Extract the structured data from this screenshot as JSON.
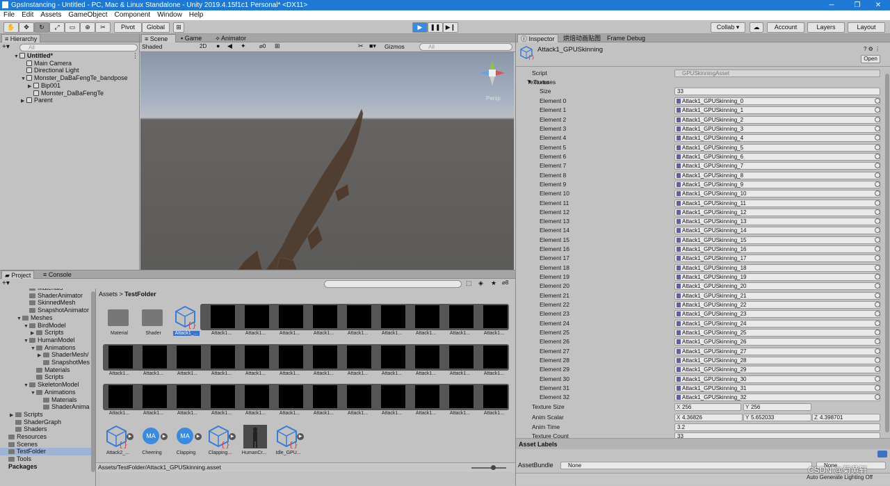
{
  "window": {
    "title": "GpsInstancing - Untitled - PC, Mac & Linux Standalone - Unity 2019.4.15f1c1 Personal* <DX11>",
    "minimize": "─",
    "maximize": "❐",
    "close": "✕"
  },
  "menu": [
    "File",
    "Edit",
    "Assets",
    "GameObject",
    "Component",
    "Window",
    "Help"
  ],
  "toolbar": {
    "pivot": "Pivot",
    "global": "Global",
    "collab": "Collab ▾",
    "account": "Account",
    "layers": "Layers",
    "layout": "Layout"
  },
  "hierarchy": {
    "tab": "Hierarchy",
    "search_placeholder": "All",
    "items": [
      {
        "label": "Untitled*",
        "level": 0,
        "icon": "unity-scene-icon",
        "expanded": true
      },
      {
        "label": "Main Camera",
        "level": 1,
        "icon": "cube-icon"
      },
      {
        "label": "Directional Light",
        "level": 1,
        "icon": "cube-icon"
      },
      {
        "label": "Monster_DaBaFengTe_bandpose",
        "level": 1,
        "icon": "cube-icon",
        "expanded": true
      },
      {
        "label": "Bip001",
        "level": 2,
        "icon": "cube-icon",
        "collapsed": true
      },
      {
        "label": "Monster_DaBaFengTe",
        "level": 2,
        "icon": "cube-icon"
      },
      {
        "label": "Parent",
        "level": 1,
        "icon": "cube-icon",
        "collapsed": true
      }
    ]
  },
  "scene": {
    "tabs": [
      "Scene",
      "Game",
      "Animator"
    ],
    "shading": "Shaded",
    "mode_2d": "2D",
    "hidden_count": "0",
    "gizmos": "Gizmos",
    "search_placeholder": "All",
    "persp": "Persp"
  },
  "project": {
    "tabs": [
      "Project",
      "Console"
    ],
    "zoom_count": "8",
    "tree": [
      {
        "label": "Materials",
        "level": 3
      },
      {
        "label": "ShaderAnimator",
        "level": 3
      },
      {
        "label": "SkinnedMesh",
        "level": 3
      },
      {
        "label": "SnapshotAnimator",
        "level": 3
      },
      {
        "label": "Meshes",
        "level": 2,
        "expanded": true
      },
      {
        "label": "BirdModel",
        "level": 3,
        "expanded": true
      },
      {
        "label": "Scripts",
        "level": 4,
        "collapsed": true
      },
      {
        "label": "HumanModel",
        "level": 3,
        "expanded": true
      },
      {
        "label": "Animations",
        "level": 4,
        "expanded": true
      },
      {
        "label": "ShaderMesh/",
        "level": 5,
        "collapsed": true
      },
      {
        "label": "SnapshotMes",
        "level": 5
      },
      {
        "label": "Materials",
        "level": 4
      },
      {
        "label": "Scripts",
        "level": 4
      },
      {
        "label": "SkeletonModel",
        "level": 3,
        "expanded": true
      },
      {
        "label": "Animations",
        "level": 4,
        "expanded": true
      },
      {
        "label": "Materials",
        "level": 5
      },
      {
        "label": "ShaderAnima",
        "level": 5
      },
      {
        "label": "Scripts",
        "level": 1,
        "collapsed": true
      },
      {
        "label": "ShaderGraph",
        "level": 1
      },
      {
        "label": "Shaders",
        "level": 1
      },
      {
        "label": "Resources",
        "level": 0
      },
      {
        "label": "Scenes",
        "level": 0
      },
      {
        "label": "TestFolder",
        "level": 0,
        "selected": true
      },
      {
        "label": "Tools",
        "level": 0
      },
      {
        "label": "Packages",
        "level": -1,
        "bold": true
      }
    ],
    "breadcrumb": [
      "Assets",
      "TestFolder"
    ],
    "row1_items": [
      "Material",
      "Shader",
      "Attack1_...",
      "Attack1...",
      "Attack1...",
      "Attack1...",
      "Attack1...",
      "Attack1...",
      "Attack1...",
      "Attack1...",
      "Attack1...",
      "Attack1..."
    ],
    "row2_items": [
      "Attack1...",
      "Attack1...",
      "Attack1...",
      "Attack1...",
      "Attack1...",
      "Attack1...",
      "Attack1...",
      "Attack1...",
      "Attack1...",
      "Attack1...",
      "Attack1...",
      "Attack1..."
    ],
    "row3_items": [
      "Attack1...",
      "Attack1...",
      "Attack1...",
      "Attack1...",
      "Attack1...",
      "Attack1...",
      "Attack1...",
      "Attack1...",
      "Attack1...",
      "Attack1...",
      "Attack1...",
      "Attack1..."
    ],
    "row4_items": [
      "Attack2_...",
      "Cheering",
      "Clapping",
      "Clapping...",
      "HumanCr...",
      "Idle_GPU..."
    ],
    "footer_path": "Assets/TestFolder/Attack1_GPUSkinning.asset"
  },
  "inspector": {
    "tabs": [
      "Inspector",
      "烘焙动画贴图",
      "Frame Debug"
    ],
    "asset_name": "Attack1_GPUSkinning",
    "open_button": "Open",
    "script_label": "Script",
    "script_value": "GPUSkinningAsset",
    "textures_label": "Textures",
    "size_label": "Size",
    "size_value": "33",
    "elements": [
      "Attack1_GPUSkinning_0",
      "Attack1_GPUSkinning_1",
      "Attack1_GPUSkinning_2",
      "Attack1_GPUSkinning_3",
      "Attack1_GPUSkinning_4",
      "Attack1_GPUSkinning_5",
      "Attack1_GPUSkinning_6",
      "Attack1_GPUSkinning_7",
      "Attack1_GPUSkinning_8",
      "Attack1_GPUSkinning_9",
      "Attack1_GPUSkinning_10",
      "Attack1_GPUSkinning_11",
      "Attack1_GPUSkinning_12",
      "Attack1_GPUSkinning_13",
      "Attack1_GPUSkinning_14",
      "Attack1_GPUSkinning_15",
      "Attack1_GPUSkinning_16",
      "Attack1_GPUSkinning_17",
      "Attack1_GPUSkinning_18",
      "Attack1_GPUSkinning_19",
      "Attack1_GPUSkinning_20",
      "Attack1_GPUSkinning_21",
      "Attack1_GPUSkinning_22",
      "Attack1_GPUSkinning_23",
      "Attack1_GPUSkinning_24",
      "Attack1_GPUSkinning_25",
      "Attack1_GPUSkinning_26",
      "Attack1_GPUSkinning_27",
      "Attack1_GPUSkinning_28",
      "Attack1_GPUSkinning_29",
      "Attack1_GPUSkinning_30",
      "Attack1_GPUSkinning_31",
      "Attack1_GPUSkinning_32"
    ],
    "element_prefix": "Element",
    "texture_size_label": "Texture Size",
    "texture_size": {
      "x": "256",
      "y": "256"
    },
    "anim_scalar_label": "Anim Scalar",
    "anim_scalar": {
      "x": "4.36826",
      "y": "5.652033",
      "z": "4.398701"
    },
    "anim_time_label": "Anim Time",
    "anim_time": "3.2",
    "texture_count_label": "Texture Count",
    "texture_count": "33",
    "asset_labels": "Asset Labels",
    "asset_bundle_label": "AssetBundle",
    "asset_bundle_value": "None",
    "asset_bundle_variant": "None",
    "auto_generate": "Auto Generate Lighting Off"
  },
  "watermark": "CSDN @菊黄轩",
  "colors": {
    "accent": "#1e78d6",
    "selection": "#3a72c4",
    "panel": "#c2c2c2"
  }
}
